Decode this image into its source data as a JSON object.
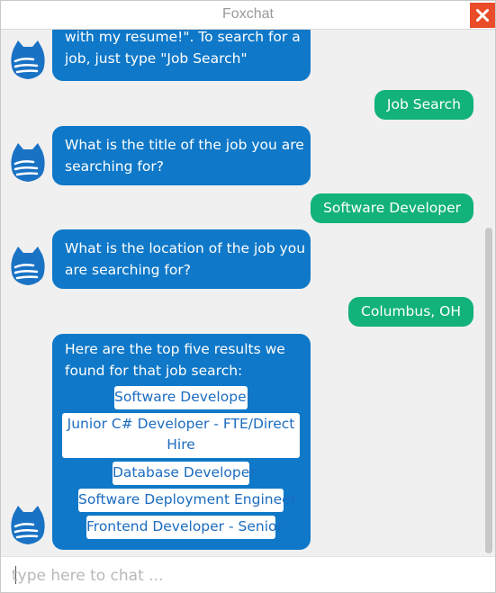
{
  "window": {
    "title": "Foxchat"
  },
  "messages": [
    {
      "from": "bot",
      "lines": [
        "with my resume!\". To search for a",
        "job, just type \"Job Search\""
      ]
    },
    {
      "from": "user",
      "text": "Job Search"
    },
    {
      "from": "bot",
      "lines": [
        "What is the title of the job you are",
        "searching for?"
      ]
    },
    {
      "from": "user",
      "text": "Software Developer"
    },
    {
      "from": "bot",
      "lines": [
        "What is the location of the job you",
        "are searching for?"
      ]
    },
    {
      "from": "user",
      "text": "Columbus, OH"
    },
    {
      "from": "bot",
      "lines": [
        "Here are the top five results we",
        "found for that job search:"
      ],
      "results": [
        {
          "label_lines": [
            "Software Developer"
          ]
        },
        {
          "label_lines": [
            "Junior C# Developer - FTE/Direct",
            "Hire"
          ]
        },
        {
          "label_lines": [
            "Database Developer"
          ]
        },
        {
          "label_lines": [
            "Software Deployment Engineer"
          ]
        },
        {
          "label_lines": [
            "Frontend Developer - Senior"
          ]
        }
      ]
    }
  ],
  "input": {
    "placeholder": "type here to chat ...",
    "value": ""
  },
  "colors": {
    "bot_bubble": "#0f78c8",
    "user_bubble": "#12b27a",
    "close_button": "#ea4c2a",
    "link_text": "#1c6cc0"
  }
}
